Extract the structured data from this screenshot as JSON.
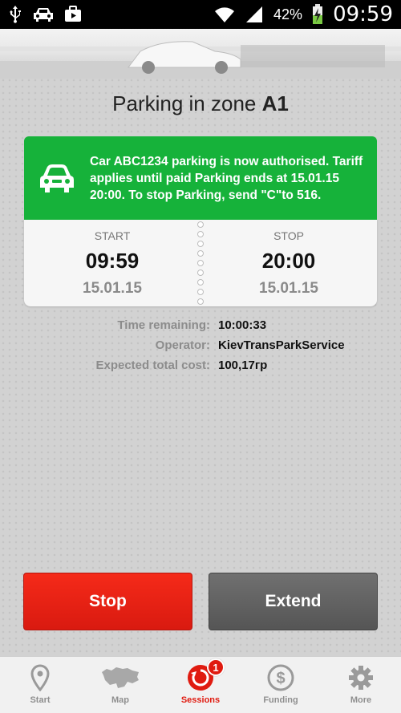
{
  "status_bar": {
    "battery_percent": "42%",
    "time": "09:59",
    "icons": [
      "usb-icon",
      "car-icon",
      "briefcase-icon",
      "wifi-icon",
      "signal-icon",
      "battery-charging-icon"
    ]
  },
  "page": {
    "title_prefix": "Parking in zone ",
    "zone": "A1"
  },
  "notice": {
    "text": "Car ABC1234 parking is now authorised. Tariff applies until paid Parking ends at 15.01.15 20:00. To stop Parking, send \"C\"to 516.",
    "icon": "car-icon",
    "color": "#16b23a"
  },
  "times": {
    "start": {
      "caption": "START",
      "time": "09:59",
      "date": "15.01.15"
    },
    "stop": {
      "caption": "STOP",
      "time": "20:00",
      "date": "15.01.15"
    }
  },
  "details": [
    {
      "label": "Time remaining:",
      "value": "10:00:33"
    },
    {
      "label": "Operator:",
      "value": "KievTransParkService"
    },
    {
      "label": "Expected total cost:",
      "value": "100,17гр"
    }
  ],
  "actions": {
    "stop_label": "Stop",
    "extend_label": "Extend",
    "stop_color": "#e8200f",
    "extend_color": "#5f5f5f"
  },
  "nav": {
    "items": [
      {
        "label": "Start",
        "icon": "map-pin-icon"
      },
      {
        "label": "Map",
        "icon": "ukraine-map-icon"
      },
      {
        "label": "Sessions",
        "icon": "sessions-icon",
        "badge": "1",
        "active": true
      },
      {
        "label": "Funding",
        "icon": "dollar-icon"
      },
      {
        "label": "More",
        "icon": "gear-icon"
      }
    ]
  }
}
